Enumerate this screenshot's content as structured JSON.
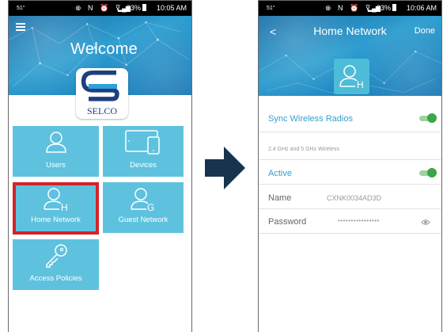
{
  "statusbar": {
    "temp": "51°",
    "icons": "⊗ N ⏰ ⊽",
    "network_type": "HD",
    "battery": "83%",
    "left_time": "10:05 AM",
    "right_time": "10:06 AM"
  },
  "left": {
    "welcome": "Welcome",
    "logo_text": "SELCO",
    "tiles": {
      "users": "Users",
      "devices": "Devices",
      "home_network": "Home Network",
      "guest_network": "Guest Network",
      "access_policies": "Access Policies"
    }
  },
  "right": {
    "title": "Home Network",
    "back": "<",
    "done": "Done",
    "sync_label": "Sync Wireless Radios",
    "band_info": "2.4 GHz and 5 GHz Wireless",
    "active_label": "Active",
    "name_label": "Name",
    "name_value": "CXNK0034AD3D",
    "password_label": "Password",
    "password_value": "••••••••••••••••",
    "sync_on": true,
    "active_on": true
  },
  "colors": {
    "tile": "#5ec2df",
    "accent": "#34a0cf",
    "highlight": "#d2232a",
    "toggle_on": "#3ca545",
    "arrow": "#17344f"
  }
}
